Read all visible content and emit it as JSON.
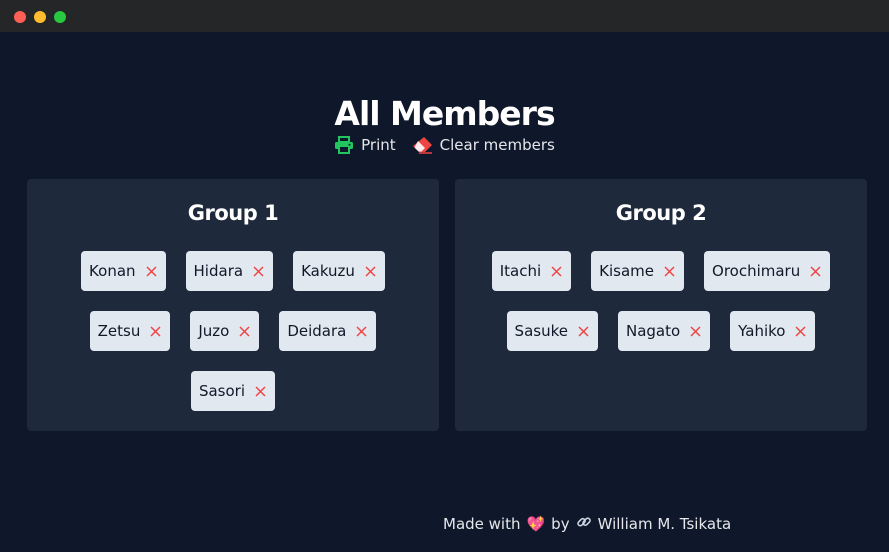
{
  "window": {
    "controls": [
      "close",
      "minimize",
      "zoom"
    ]
  },
  "header": {
    "title": "All Members",
    "print_label": "Print",
    "clear_label": "Clear members",
    "print_icon": "printer-icon",
    "clear_icon": "eraser-icon",
    "print_color": "#22c55e",
    "clear_color": "#ef4444"
  },
  "groups": [
    {
      "title": "Group 1",
      "members": [
        "Konan",
        "Hidara",
        "Kakuzu",
        "Zetsu",
        "Juzo",
        "Deidara",
        "Sasori"
      ]
    },
    {
      "title": "Group 2",
      "members": [
        "Itachi",
        "Kisame",
        "Orochimaru",
        "Sasuke",
        "Nagato",
        "Yahiko"
      ]
    }
  ],
  "chip": {
    "remove_icon": "close-icon",
    "remove_color": "#ef4444"
  },
  "footer": {
    "made_with": "Made with",
    "heart": "💖",
    "by": "by",
    "link_icon": "link-icon",
    "author": "William M. Tsikata"
  }
}
